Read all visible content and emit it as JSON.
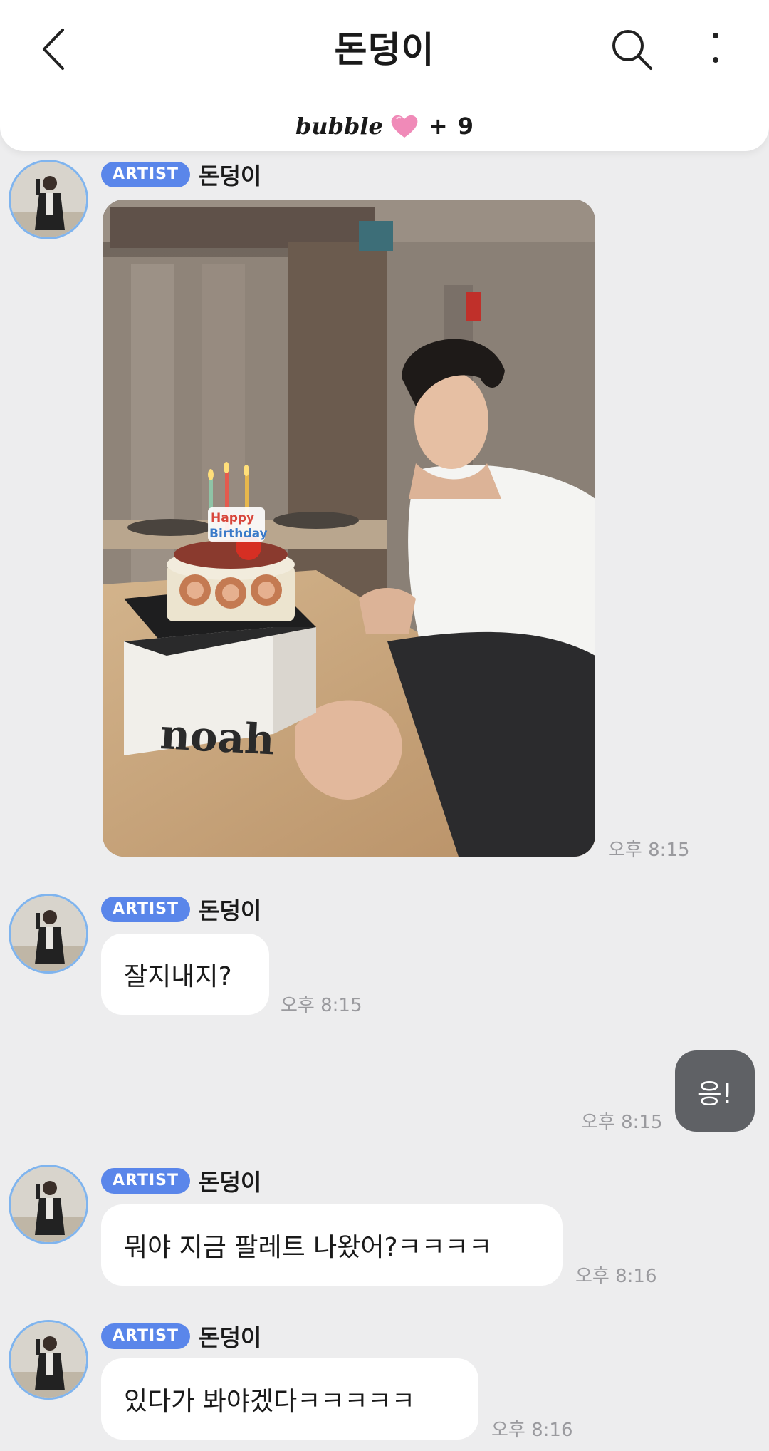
{
  "header": {
    "title": "돈덩이",
    "bubble_logo": "bubble",
    "bubble_plus": "+",
    "bubble_count": "9"
  },
  "photo": {
    "candle_topper_line1": "Happy",
    "candle_topper_line2": "Birthday",
    "box_brand": "noah"
  },
  "messages": [
    {
      "type": "image",
      "badge": "ARTIST",
      "sender": "돈덩이",
      "time": "오후 8:15"
    },
    {
      "type": "text",
      "badge": "ARTIST",
      "sender": "돈덩이",
      "text": "잘지내지?",
      "time": "오후 8:15"
    },
    {
      "type": "mine",
      "text": "응!",
      "time": "오후 8:15"
    },
    {
      "type": "text",
      "badge": "ARTIST",
      "sender": "돈덩이",
      "text": "뭐야 지금 팔레트 나왔어?ㅋㅋㅋㅋ",
      "time": "오후 8:16"
    },
    {
      "type": "text",
      "badge": "ARTIST",
      "sender": "돈덩이",
      "text": "있다가 봐야겠다ㅋㅋㅋㅋㅋ",
      "time": "오후 8:16"
    }
  ],
  "colors": {
    "badge": "#5a86ea",
    "avatar_ring": "#7fb4ee",
    "my_bubble": "#5f6165",
    "background": "#ededee"
  }
}
